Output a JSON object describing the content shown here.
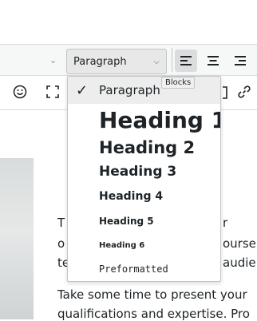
{
  "toolbar": {
    "block_select_value": "Paragraph"
  },
  "dropdown": {
    "tooltip": "Blocks",
    "items": [
      {
        "label": "Paragraph",
        "checked": true
      },
      {
        "label": "Heading 1",
        "checked": false
      },
      {
        "label": "Heading 2",
        "checked": false
      },
      {
        "label": "Heading 3",
        "checked": false
      },
      {
        "label": "Heading 4",
        "checked": false
      },
      {
        "label": "Heading 5",
        "checked": false
      },
      {
        "label": "Heading 6",
        "checked": false
      },
      {
        "label": "Preformatted",
        "checked": false
      }
    ]
  },
  "content": {
    "line1_left": "T",
    "line1_right": "r",
    "line2_left": "o",
    "line2_right": "ourse",
    "line3_left": "te",
    "line3_right": "audien",
    "para2_line1": "Take some time to present your",
    "para2_line2": "qualifications and expertise. Pro"
  },
  "icons": [
    "chevron-down-icon",
    "align-left-icon",
    "align-center-icon",
    "align-right-icon",
    "emoji-icon",
    "fullscreen-icon",
    "link-icon",
    "checkmark-icon"
  ]
}
